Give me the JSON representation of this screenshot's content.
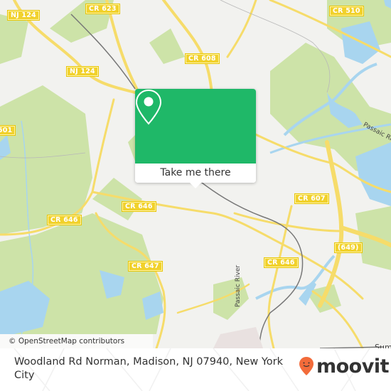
{
  "map": {
    "attribution": "© OpenStreetMap contributors",
    "colors": {
      "background": "#f2f2ef",
      "forest": "#cde3a8",
      "water": "#a8d5ef",
      "road": "#f6dc6a",
      "rail": "#777777",
      "shield": "#f1d12b"
    },
    "road_labels": [
      {
        "id": "nj124-top",
        "text": "NJ 124"
      },
      {
        "id": "cr623",
        "text": "CR 623"
      },
      {
        "id": "cr510",
        "text": "CR 510"
      },
      {
        "id": "nj124-mid",
        "text": "NJ 124"
      },
      {
        "id": "cr608",
        "text": "CR 608"
      },
      {
        "id": "cr501",
        "text": "501"
      },
      {
        "id": "cr646-center",
        "text": "CR 646"
      },
      {
        "id": "cr646-left",
        "text": "CR 646"
      },
      {
        "id": "cr607",
        "text": "CR 607"
      },
      {
        "id": "cr649",
        "text": "(649)"
      },
      {
        "id": "cr646-right",
        "text": "CR 646"
      },
      {
        "id": "cr647",
        "text": "CR 647"
      }
    ],
    "place_labels": [
      {
        "id": "passaic-river-ne",
        "text": "Passaic River"
      },
      {
        "id": "passaic-river-s",
        "text": "Passaic River"
      },
      {
        "id": "summit-partial",
        "text": "Sum"
      }
    ]
  },
  "popup": {
    "icon": "map-pin-icon",
    "button_label": "Take me there",
    "color": "#1fb868"
  },
  "footer": {
    "address": "Woodland Rd Norman, Madison, NJ 07940, New York City",
    "brand": "moovit",
    "brand_icon": "moovit-smiley-pin-icon",
    "brand_color": "#f26b3a"
  }
}
